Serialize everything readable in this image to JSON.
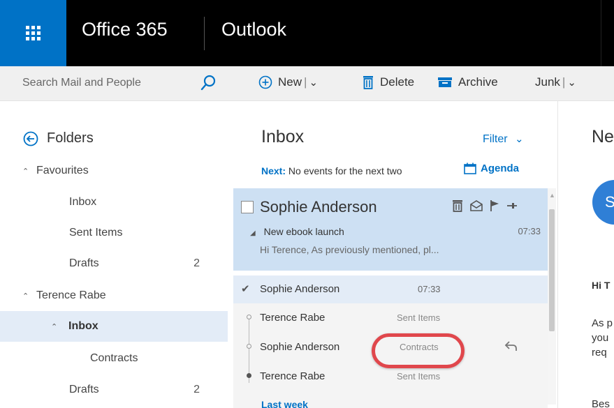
{
  "topbar": {
    "brand": "Office 365",
    "app": "Outlook",
    "waffle_icon": "app-launcher-icon",
    "colors": {
      "waffle_bg": "#0072c6",
      "bar_bg": "#000000"
    }
  },
  "search": {
    "placeholder": "Search Mail and People",
    "icon": "search-icon"
  },
  "toolbar": {
    "new_label": "New",
    "delete_label": "Delete",
    "archive_label": "Archive",
    "junk_label": "Junk"
  },
  "folders": {
    "title": "Folders",
    "favourites": {
      "label": "Favourites",
      "items": [
        {
          "label": "Inbox",
          "count": ""
        },
        {
          "label": "Sent Items",
          "count": ""
        },
        {
          "label": "Drafts",
          "count": "2"
        }
      ]
    },
    "account": {
      "label": "Terence Rabe",
      "items": [
        {
          "label": "Inbox",
          "count": "",
          "selected": true
        },
        {
          "label": "Contracts",
          "count": ""
        },
        {
          "label": "Drafts",
          "count": "2"
        }
      ]
    }
  },
  "message_list": {
    "title": "Inbox",
    "filter_label": "Filter",
    "next_label": "Next:",
    "next_text": "No events for the next two",
    "agenda_label": "Agenda",
    "selected_message": {
      "sender": "Sophie Anderson",
      "subject": "New ebook launch",
      "time": "07:33",
      "preview": "Hi Terence,   As previously mentioned, pl..."
    },
    "thread": {
      "head": {
        "sender": "Sophie Anderson",
        "time": "07:33"
      },
      "rows": [
        {
          "sender": "Terence Rabe",
          "folder": "Sent Items"
        },
        {
          "sender": "Sophie Anderson",
          "folder": "Contracts"
        },
        {
          "sender": "Terence Rabe",
          "folder": "Sent Items"
        }
      ]
    },
    "section_label": "Last week"
  },
  "reading_pane": {
    "title": "Ne",
    "avatar_initial": "S",
    "greeting": "Hi T",
    "lines": [
      "As p",
      "you",
      "req",
      "Bes"
    ]
  },
  "colors": {
    "accent": "#0072c6",
    "highlight": "#e0474c",
    "selected_bg": "#cde0f3"
  }
}
